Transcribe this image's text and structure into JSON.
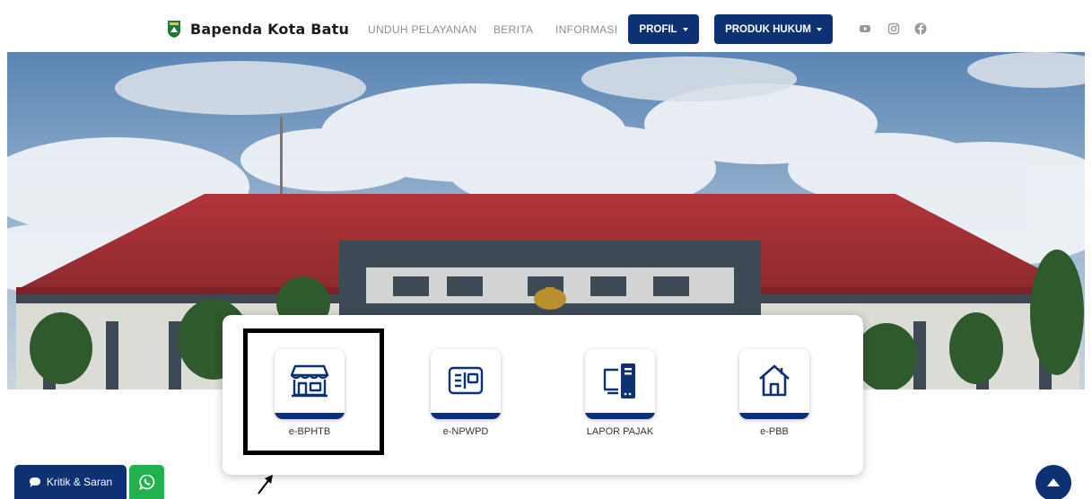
{
  "navbar": {
    "brand": "Bapenda Kota Batu",
    "links": [
      "UNDUH PELAYANAN",
      "BERITA",
      "INFORMASI"
    ],
    "profil_label": "PROFIL",
    "produk_label": "PRODUK HUKUM",
    "social_icons": [
      "youtube-icon",
      "instagram-icon",
      "facebook-icon"
    ]
  },
  "services": [
    {
      "label": "e-BPHTB",
      "icon": "store-icon"
    },
    {
      "label": "e-NPWPD",
      "icon": "id-card-icon"
    },
    {
      "label": "LAPOR PAJAK",
      "icon": "computer-icon"
    },
    {
      "label": "e-PBB",
      "icon": "house-icon"
    }
  ],
  "widgets": {
    "kritik_label": "Kritik & Saran",
    "whatsapp_icon": "whatsapp-icon",
    "back_to_top_icon": "arrow-up-icon"
  },
  "colors": {
    "primary": "#0d3173",
    "whatsapp": "#23b14d",
    "nav_text": "#8d8d8d"
  }
}
